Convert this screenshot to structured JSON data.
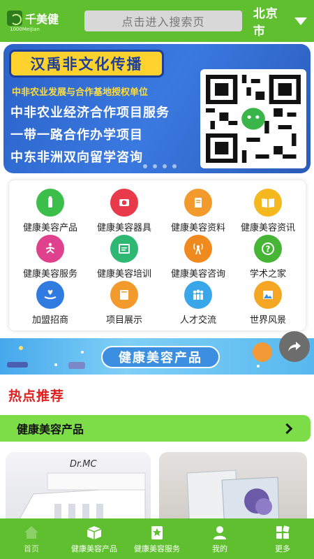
{
  "header": {
    "logo_name": "千美健",
    "logo_sub": "1000MeiJian",
    "search_placeholder": "点击进入搜索页",
    "city": "北京市"
  },
  "banner": {
    "title": "汉禹非文化传播",
    "subtitle": "中非农业发展与合作基地授权单位",
    "lines": [
      "中非农业经济合作项目服务",
      "一带一路合作办学项目",
      "中东非洲双向留学咨询"
    ]
  },
  "categories": [
    {
      "label": "健康美容产品",
      "icon": "product-icon",
      "color": "#3cbf4a"
    },
    {
      "label": "健康美容器具",
      "icon": "device-icon",
      "color": "#e83a4a"
    },
    {
      "label": "健康美容资料",
      "icon": "document-icon",
      "color": "#f29b2c"
    },
    {
      "label": "健康美容资讯",
      "icon": "book-icon",
      "color": "#f5b81f"
    },
    {
      "label": "健康美容服务",
      "icon": "yoga-icon",
      "color": "#e0418c"
    },
    {
      "label": "健康美容培训",
      "icon": "training-icon",
      "color": "#2fb874"
    },
    {
      "label": "健康美容咨询",
      "icon": "signal-icon",
      "color": "#f08a1e"
    },
    {
      "label": "学术之家",
      "icon": "question-icon",
      "color": "#46b535"
    },
    {
      "label": "加盟招商",
      "icon": "hand-heart-icon",
      "color": "#2f7be0"
    },
    {
      "label": "项目展示",
      "icon": "display-icon",
      "color": "#f29b2c"
    },
    {
      "label": "人才交流",
      "icon": "people-icon",
      "color": "#38a6e8"
    },
    {
      "label": "世界风景",
      "icon": "landscape-icon",
      "color": "#f5a623"
    }
  ],
  "product_banner": {
    "title": "健康美容产品"
  },
  "hot": {
    "title": "热点推荐"
  },
  "category_bar": {
    "label": "健康美容产品"
  },
  "products": [
    {
      "brand": "Dr.MC"
    },
    {
      "brand": ""
    }
  ],
  "nav": [
    {
      "label": "首页",
      "icon": "home-icon"
    },
    {
      "label": "健康美容产品",
      "icon": "box-icon"
    },
    {
      "label": "健康美容服务",
      "icon": "star-tag-icon"
    },
    {
      "label": "我的",
      "icon": "user-icon"
    },
    {
      "label": "更多",
      "icon": "grid-icon"
    }
  ]
}
